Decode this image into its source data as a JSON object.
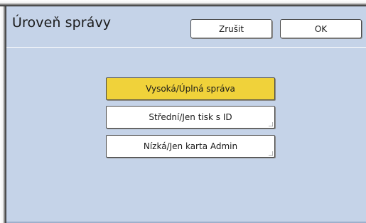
{
  "dialog": {
    "title": "Úroveň správy",
    "cancel_label": "Zrušit",
    "ok_label": "OK"
  },
  "options": [
    {
      "label": "Vysoká/Úplná správa",
      "selected": true
    },
    {
      "label": "Střední/Jen tisk s ID",
      "selected": false
    },
    {
      "label": "Nízká/Jen karta Admin",
      "selected": false
    }
  ],
  "colors": {
    "screen_background": "#c5d3e8",
    "selected_option": "#f0d23a",
    "button_background": "#ffffff"
  }
}
